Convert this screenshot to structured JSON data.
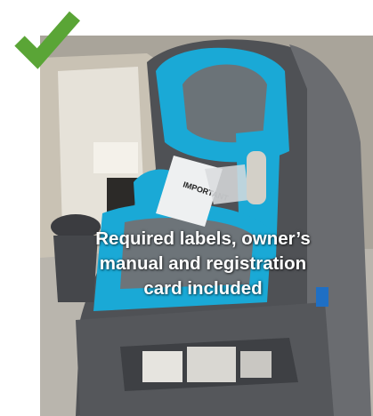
{
  "caption": {
    "line1": "Required labels, owner’s",
    "line2": "manual and registration",
    "line3": "card included"
  },
  "photo": {
    "subject": "car-seat",
    "booklet_label": "IMPORTANT"
  },
  "colors": {
    "check": "#5aa536",
    "seat_blue": "#1aa9d6",
    "seat_gray": "#5d5f63",
    "caption_text": "#ffffff"
  },
  "icons": {
    "check": "checkmark-icon"
  }
}
